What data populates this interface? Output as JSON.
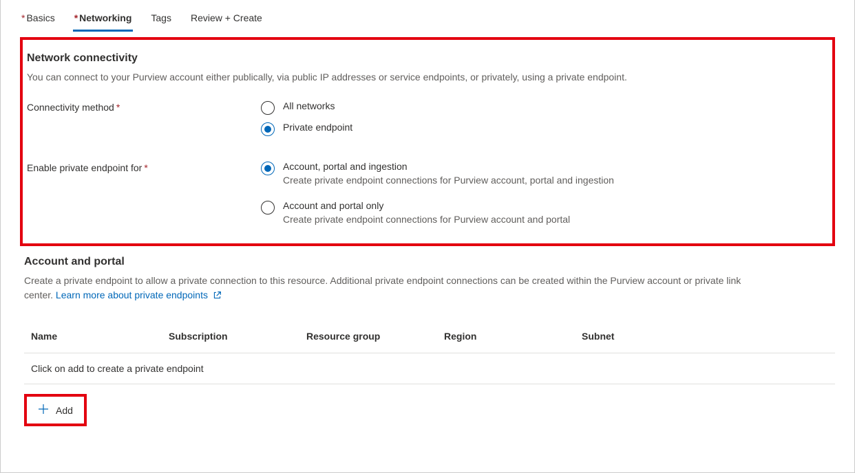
{
  "tabs": {
    "basics": "Basics",
    "networking": "Networking",
    "tags": "Tags",
    "review": "Review + Create"
  },
  "network": {
    "title": "Network connectivity",
    "desc": "You can connect to your Purview account either publically, via public IP addresses or service endpoints, or privately, using a private endpoint.",
    "conn_label": "Connectivity method",
    "opt_all": "All networks",
    "opt_pe": "Private endpoint",
    "enable_label": "Enable private endpoint for",
    "opt_full": "Account, portal and ingestion",
    "opt_full_sub": "Create private endpoint connections for Purview account, portal and ingestion",
    "opt_portal": "Account and portal only",
    "opt_portal_sub": "Create private endpoint connections for Purview account and portal"
  },
  "ap": {
    "title": "Account and portal",
    "desc_a": "Create a private endpoint to allow a private connection to this resource. Additional private endpoint connections can be created within the Purview account or private link center. ",
    "link": "Learn more about private endpoints",
    "cols": {
      "name": "Name",
      "sub": "Subscription",
      "rg": "Resource group",
      "region": "Region",
      "subnet": "Subnet"
    },
    "empty": "Click on add to create a private endpoint",
    "add": "Add"
  }
}
